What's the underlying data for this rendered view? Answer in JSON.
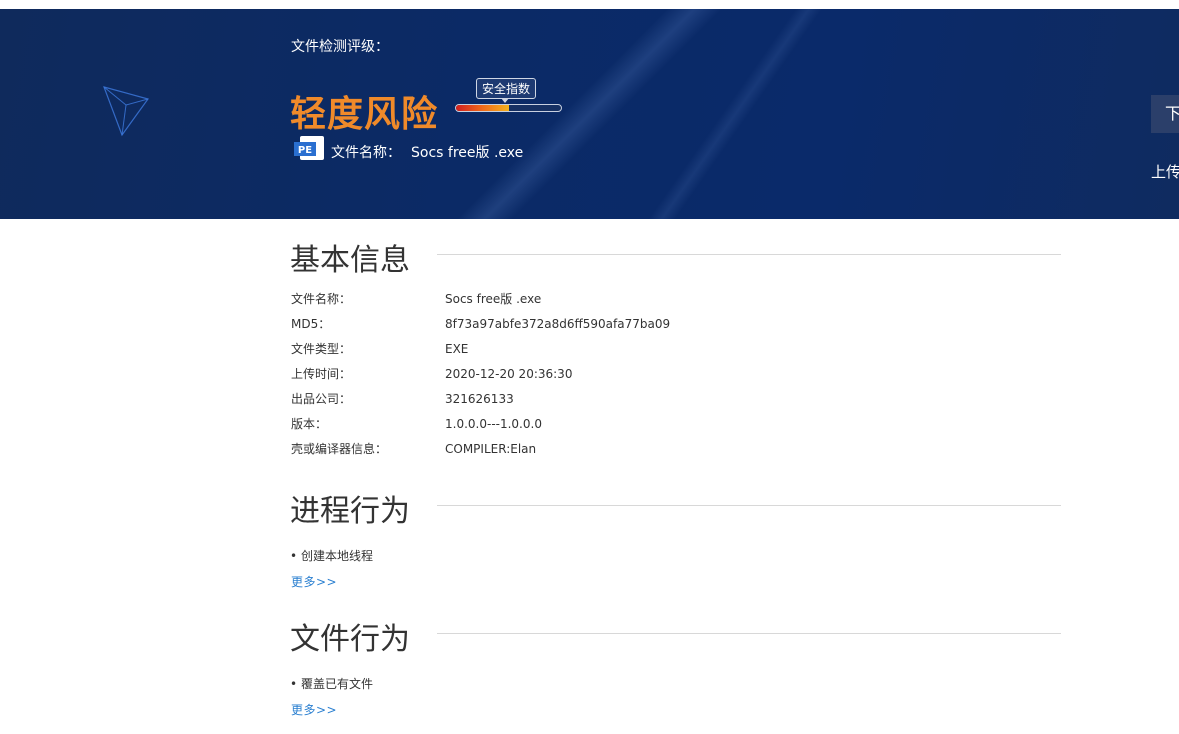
{
  "hero": {
    "rating_label": "文件检测评级：",
    "risk_level": "轻度风险",
    "safety_index_label": "安全指数",
    "safety_index_fill_percent": 50,
    "file_name_label": "文件名称：",
    "file_name_value": "Socs free版 .exe",
    "file_type_badge": "PE",
    "download_label": "下",
    "upload_label": "上传"
  },
  "basic_info": {
    "title": "基本信息",
    "rows": [
      {
        "label": "文件名称：",
        "value": "Socs free版 .exe"
      },
      {
        "label": "MD5：",
        "value": "8f73a97abfe372a8d6ff590afa77ba09"
      },
      {
        "label": "文件类型：",
        "value": "EXE"
      },
      {
        "label": "上传时间：",
        "value": "2020-12-20 20:36:30"
      },
      {
        "label": "出品公司：",
        "value": "321626133"
      },
      {
        "label": "版本：",
        "value": "1.0.0.0---1.0.0.0"
      },
      {
        "label": "壳或编译器信息：",
        "value": "COMPILER:Elan"
      }
    ]
  },
  "process_behavior": {
    "title": "进程行为",
    "items": [
      "创建本地线程"
    ],
    "more": "更多>>"
  },
  "file_behavior": {
    "title": "文件行为",
    "items": [
      "覆盖已有文件"
    ],
    "more": "更多>>"
  },
  "colors": {
    "risk": "#f08a2a",
    "hero_bg": "#0b2a66",
    "link": "#2a7fd0"
  }
}
